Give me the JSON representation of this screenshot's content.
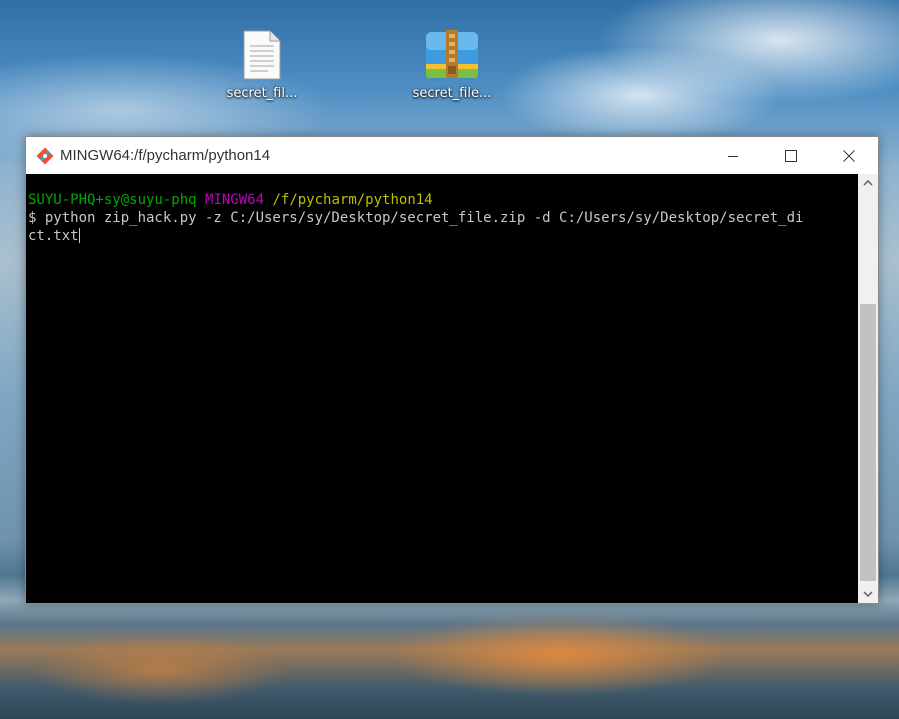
{
  "desktop": {
    "icons": [
      {
        "label": "secret_fil...",
        "icon": "text-file-icon"
      },
      {
        "label": "secret_file...",
        "icon": "zip-archive-icon"
      }
    ]
  },
  "window": {
    "title": "MINGW64:/f/pycharm/python14",
    "app_icon": "git-bash-icon",
    "controls": [
      "minimize-icon",
      "maximize-icon",
      "close-icon"
    ]
  },
  "terminal": {
    "prompt_user": "SUYU-PHQ+sy@suyu-phq",
    "prompt_env": "MINGW64",
    "prompt_path": "/f/pycharm/python14",
    "command_line1": "$ python zip_hack.py -z C:/Users/sy/Desktop/secret_file.zip -d C:/Users/sy/Desktop/secret_di",
    "command_line2": "ct.txt"
  },
  "colors": {
    "prompt_user": "#00a800",
    "prompt_env": "#bf00bf",
    "prompt_path": "#bfbf00",
    "terminal_bg": "#000000"
  }
}
